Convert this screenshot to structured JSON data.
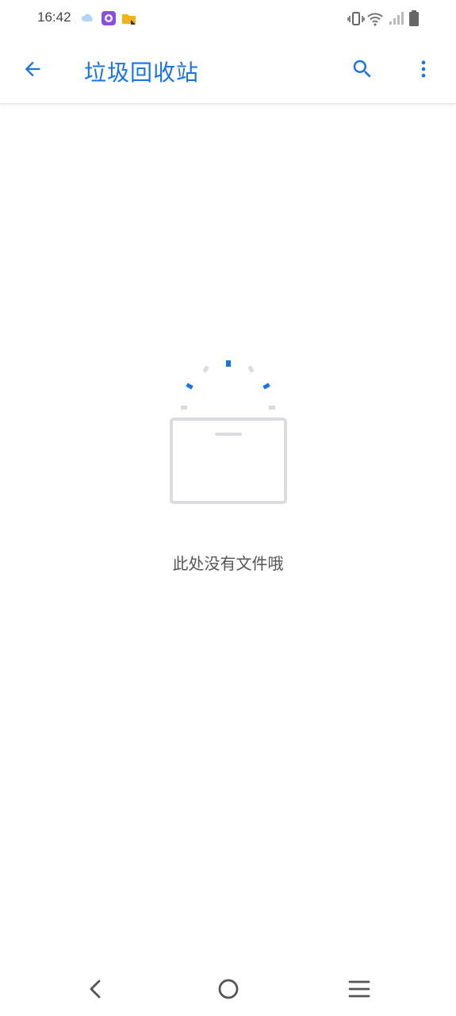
{
  "status_bar": {
    "time": "16:42",
    "notification_icons": [
      "cloud-icon",
      "camera-app-icon",
      "folder-app-icon"
    ],
    "system_icons": [
      "vibrate-icon",
      "wifi-icon",
      "cell-signal-icon",
      "battery-icon"
    ]
  },
  "app_bar": {
    "title": "垃圾回收站",
    "back_icon": "arrow-back-icon",
    "search_icon": "search-icon",
    "more_icon": "more-vert-icon"
  },
  "empty_state": {
    "message": "此处没有文件哦",
    "illustration": "empty-box-icon"
  },
  "nav_bar": {
    "buttons": [
      "back-icon",
      "home-icon",
      "recents-icon"
    ]
  },
  "colors": {
    "accent": "#1a73e8",
    "text_secondary": "#555555",
    "illustration_gray": "#dadce0",
    "background": "#ffffff"
  }
}
